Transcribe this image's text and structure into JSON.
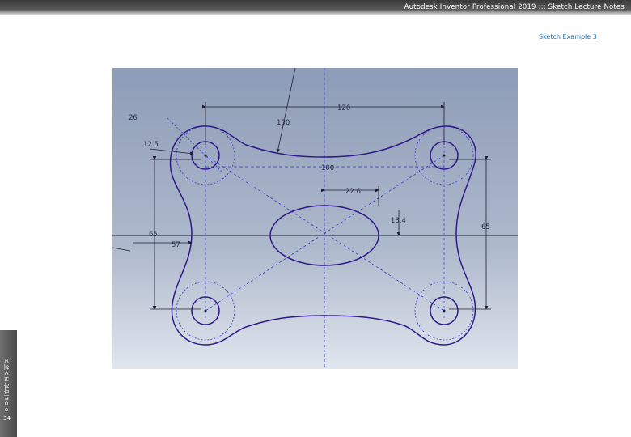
{
  "header": {
    "title": "Autodesk Inventor Professional 2019 ::: Sketch Lecture Notes",
    "subtitle": "Sketch Example 3"
  },
  "sidebar": {
    "label": "ㅇㅇ트다하고오해요",
    "page_number": "34"
  },
  "sketch": {
    "dimensions": {
      "d26": "26",
      "d12_5": "12.5",
      "d120": "120",
      "d100_diag": "100",
      "d100_horiz": "100",
      "d22_6": "22.6",
      "d13_4": "13.4",
      "d65_left": "65",
      "d65_right": "65",
      "d57": "57"
    },
    "colors": {
      "profile": "#2e1a8a",
      "construction": "#3a3acb",
      "dimension": "#1c1f33",
      "background_top": "#8c9bb6",
      "background_bottom": "#dde3ec"
    }
  }
}
